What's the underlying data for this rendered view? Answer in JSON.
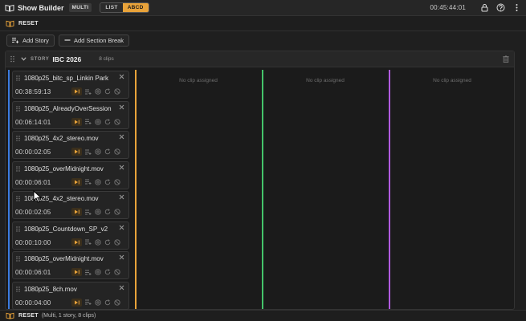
{
  "app": {
    "title": "Show Builder",
    "mode_badge": "MULTI",
    "view_list": "LIST",
    "view_abcd": "ABCD",
    "clock": "00:45:44:01",
    "accent": "#e9a33a"
  },
  "reset_bar": {
    "label": "RESET"
  },
  "toolbar": {
    "add_story": "Add Story",
    "add_section_break": "Add Section Break"
  },
  "story": {
    "tag": "STORY",
    "name": "IBC 2026",
    "clip_count": "8 clips"
  },
  "lanes": [
    {
      "color": "#3b7be0",
      "empty_text": ""
    },
    {
      "color": "#e9a33a",
      "empty_text": "No clip assigned"
    },
    {
      "color": "#44c46a",
      "empty_text": "No clip assigned"
    },
    {
      "color": "#b25be0",
      "empty_text": "No clip assigned"
    }
  ],
  "clips": [
    {
      "name": "1080p25_bitc_sp_Linkin Park",
      "duration": "00:38:59:13"
    },
    {
      "name": "1080p25_AlreadyOverSession",
      "duration": "00:06:14:01"
    },
    {
      "name": "1080p25_4x2_stereo.mov",
      "duration": "00:00:02:05"
    },
    {
      "name": "1080p25_overMidnight.mov",
      "duration": "00:00:06:01"
    },
    {
      "name": "1080p25_4x2_stereo.mov",
      "duration": "00:00:02:05"
    },
    {
      "name": "1080p25_Countdown_SP_v2",
      "duration": "00:00:10:00"
    },
    {
      "name": "1080p25_overMidnight.mov",
      "duration": "00:00:06:01"
    },
    {
      "name": "1080p25_8ch.mov",
      "duration": "00:00:04:00"
    }
  ],
  "status": {
    "label": "RESET",
    "detail": "(Multi, 1 story, 8 clips)"
  }
}
